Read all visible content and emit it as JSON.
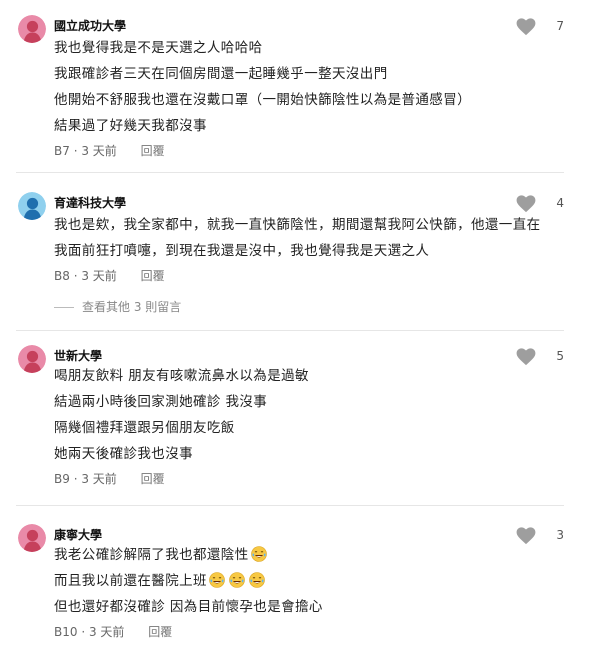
{
  "comments": [
    {
      "school": "國立成功大學",
      "likes": "7",
      "lines": [
        {
          "text": "我也覺得我是不是天選之人哈哈哈"
        },
        {
          "text": "我跟確診者三天在同個房間還一起睡幾乎一整天沒出門"
        },
        {
          "text": "他開始不舒服我也還在沒戴口罩（一開始快篩陰性以為是普通感冒）"
        },
        {
          "text": "結果過了好幾天我都沒事"
        }
      ],
      "floor": "B7",
      "time": "3 天前",
      "reply": "回覆",
      "avatar_color": "#e98aa8"
    },
    {
      "school": "育達科技大學",
      "likes": "4",
      "lines": [
        {
          "text": "我也是欸，我全家都中，就我一直快篩陰性，期間還幫我阿公快篩，他還一直在"
        },
        {
          "text": "我面前狂打噴嚏，到現在我還是沒中，我也覺得我是天選之人"
        }
      ],
      "floor": "B8",
      "time": "3 天前",
      "reply": "回覆",
      "more_replies": "查看其他 3 則留言",
      "avatar_color": "#8fd0ee"
    },
    {
      "school": "世新大學",
      "likes": "5",
      "lines": [
        {
          "text": "喝朋友飲料 朋友有咳嗽流鼻水以為是過敏"
        },
        {
          "text": "結過兩小時後回家測她確診 我沒事"
        },
        {
          "text": "隔幾個禮拜還跟另個朋友吃飯"
        },
        {
          "text": "她兩天後確診我也沒事"
        }
      ],
      "floor": "B9",
      "time": "3 天前",
      "reply": "回覆",
      "avatar_color": "#e98aa8"
    },
    {
      "school": "康寧大學",
      "likes": "3",
      "lines": [
        {
          "text": "我老公確診解隔了我也都還陰性",
          "emojis": 1
        },
        {
          "text": "而且我以前還在醫院上班",
          "emojis": 3
        },
        {
          "text": "但也還好都沒確診 因為目前懷孕也是會擔心"
        }
      ],
      "floor": "B10",
      "time": "3 天前",
      "reply": "回覆",
      "avatar_color": "#e98aa8"
    }
  ],
  "icons": {
    "heart": "heart-icon",
    "emoji": "laughing-tears-emoji-icon"
  },
  "colors": {
    "heart": "#9e9e9e",
    "divider": "#e6e6e6",
    "emoji_face": "#f7c843"
  }
}
